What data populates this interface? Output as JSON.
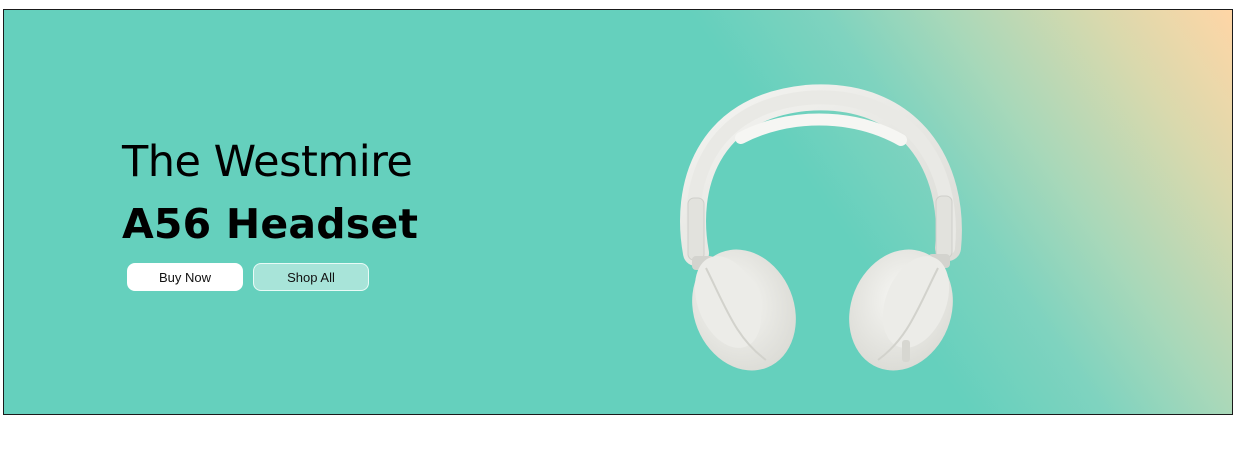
{
  "hero": {
    "headline_line1": "The Westmire",
    "headline_line2": "A56 Headset",
    "buttons": {
      "buy_now": "Buy Now",
      "shop_all": "Shop All"
    },
    "product_image": "headphones-image",
    "colors": {
      "background": "#65d0bd",
      "accent_corner": "#ffd6a6",
      "primary_button": "#ffffff",
      "secondary_button": "#a8e4d9",
      "text": "#000000"
    }
  }
}
